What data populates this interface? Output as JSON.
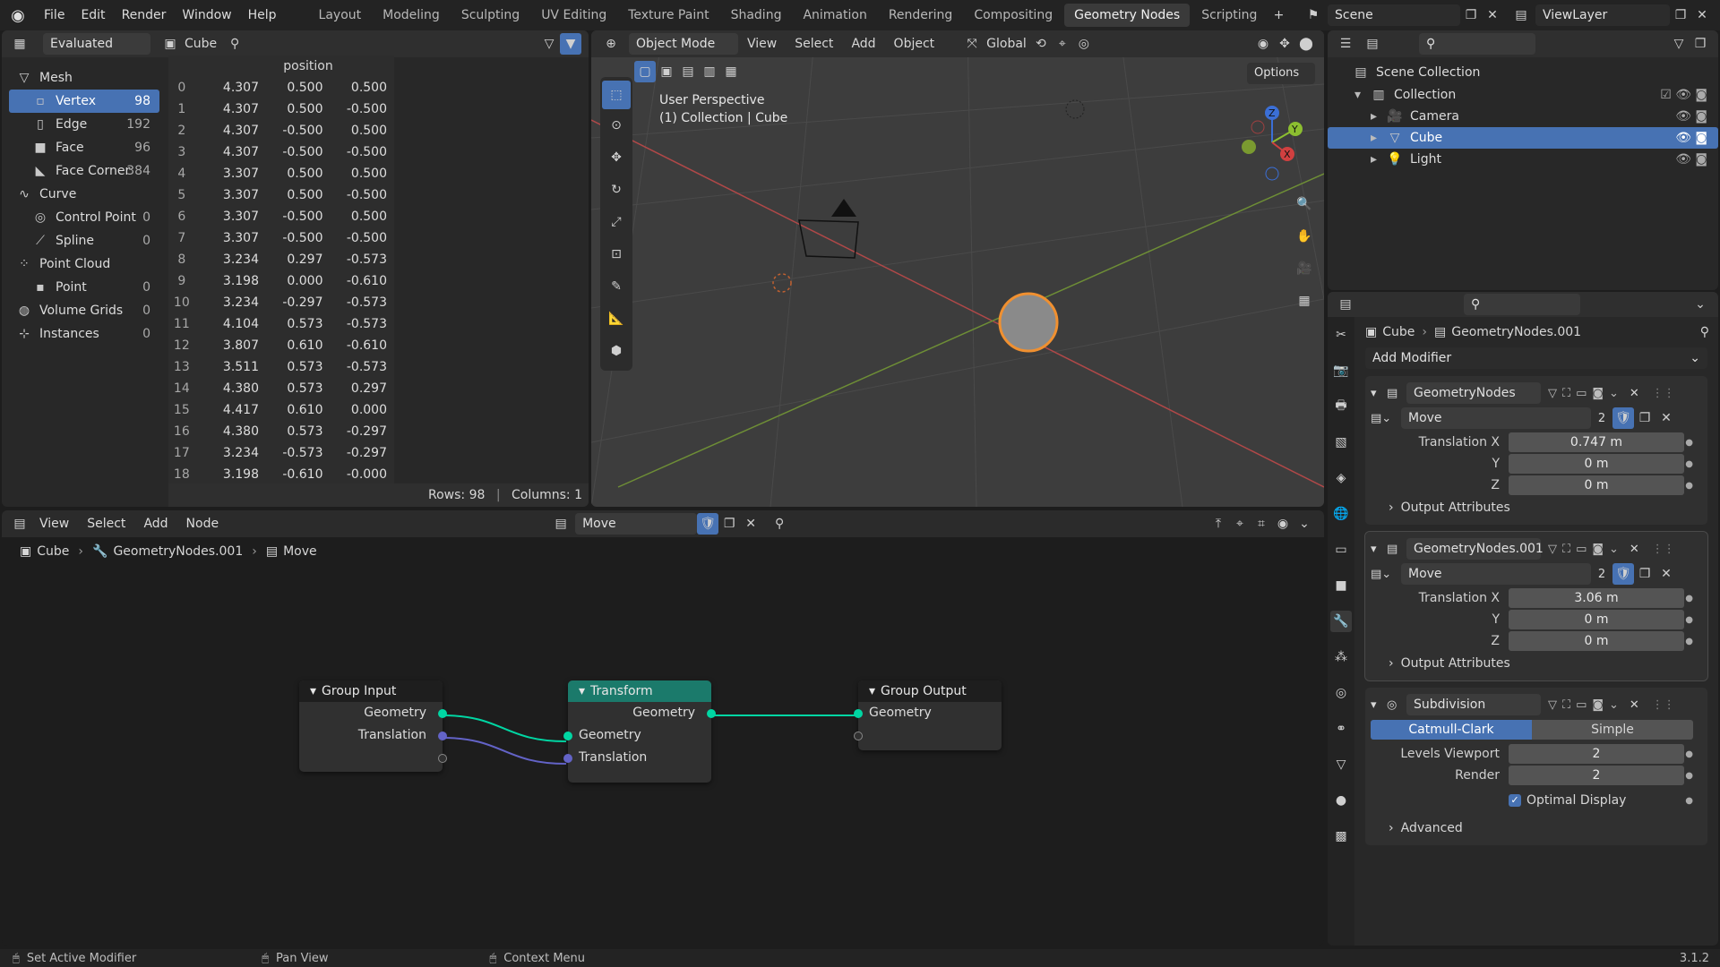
{
  "topbar": {
    "menus": [
      "File",
      "Edit",
      "Render",
      "Window",
      "Help"
    ],
    "workspaces": [
      "Layout",
      "Modeling",
      "Sculpting",
      "UV Editing",
      "Texture Paint",
      "Shading",
      "Animation",
      "Rendering",
      "Compositing",
      "Geometry Nodes",
      "Scripting"
    ],
    "active_workspace": "Geometry Nodes",
    "scene": "Scene",
    "viewlayer": "ViewLayer"
  },
  "spreadsheet": {
    "mode": "Evaluated",
    "object": "Cube",
    "column_header": "position",
    "tree": [
      {
        "label": "Mesh",
        "count": "",
        "indent": 0,
        "icon": "mesh-icon"
      },
      {
        "label": "Vertex",
        "count": "98",
        "indent": 1,
        "icon": "vertex-icon",
        "selected": true
      },
      {
        "label": "Edge",
        "count": "192",
        "indent": 1,
        "icon": "edge-icon"
      },
      {
        "label": "Face",
        "count": "96",
        "indent": 1,
        "icon": "face-icon"
      },
      {
        "label": "Face Corner",
        "count": "384",
        "indent": 1,
        "icon": "face-corner-icon"
      },
      {
        "label": "Curve",
        "count": "",
        "indent": 0,
        "icon": "curve-icon"
      },
      {
        "label": "Control Point",
        "count": "0",
        "indent": 1,
        "icon": "control-point-icon"
      },
      {
        "label": "Spline",
        "count": "0",
        "indent": 1,
        "icon": "spline-icon"
      },
      {
        "label": "Point Cloud",
        "count": "",
        "indent": 0,
        "icon": "point-cloud-icon"
      },
      {
        "label": "Point",
        "count": "0",
        "indent": 1,
        "icon": "point-icon"
      },
      {
        "label": "Volume Grids",
        "count": "0",
        "indent": 0,
        "icon": "volume-icon"
      },
      {
        "label": "Instances",
        "count": "0",
        "indent": 0,
        "icon": "instances-icon"
      }
    ],
    "rows": [
      [
        "0",
        "4.307",
        "0.500",
        "0.500"
      ],
      [
        "1",
        "4.307",
        "0.500",
        "-0.500"
      ],
      [
        "2",
        "4.307",
        "-0.500",
        "0.500"
      ],
      [
        "3",
        "4.307",
        "-0.500",
        "-0.500"
      ],
      [
        "4",
        "3.307",
        "0.500",
        "0.500"
      ],
      [
        "5",
        "3.307",
        "0.500",
        "-0.500"
      ],
      [
        "6",
        "3.307",
        "-0.500",
        "0.500"
      ],
      [
        "7",
        "3.307",
        "-0.500",
        "-0.500"
      ],
      [
        "8",
        "3.234",
        "0.297",
        "-0.573"
      ],
      [
        "9",
        "3.198",
        "0.000",
        "-0.610"
      ],
      [
        "10",
        "3.234",
        "-0.297",
        "-0.573"
      ],
      [
        "11",
        "4.104",
        "0.573",
        "-0.573"
      ],
      [
        "12",
        "3.807",
        "0.610",
        "-0.610"
      ],
      [
        "13",
        "3.511",
        "0.573",
        "-0.573"
      ],
      [
        "14",
        "4.380",
        "0.573",
        "0.297"
      ],
      [
        "15",
        "4.417",
        "0.610",
        "0.000"
      ],
      [
        "16",
        "4.380",
        "0.573",
        "-0.297"
      ],
      [
        "17",
        "3.234",
        "-0.573",
        "-0.297"
      ],
      [
        "18",
        "3.198",
        "-0.610",
        "-0.000"
      ]
    ],
    "footer_rows": "Rows: 98",
    "footer_cols": "Columns: 1"
  },
  "viewport": {
    "mode": "Object Mode",
    "menus": [
      "View",
      "Select",
      "Add",
      "Object"
    ],
    "orientation": "Global",
    "options": "Options",
    "overlay_title": "User Perspective",
    "overlay_sub": "(1) Collection | Cube"
  },
  "outliner": {
    "root": "Scene Collection",
    "collection": "Collection",
    "items": [
      {
        "label": "Camera",
        "icon": "camera-icon"
      },
      {
        "label": "Cube",
        "icon": "mesh-object-icon",
        "selected": true
      },
      {
        "label": "Light",
        "icon": "light-icon"
      }
    ]
  },
  "properties": {
    "breadcrumb_obj": "Cube",
    "breadcrumb_tree": "GeometryNodes.001",
    "add_modifier": "Add Modifier",
    "mod1": {
      "name": "GeometryNodes",
      "group": "Move",
      "users": "2",
      "tx_label": "Translation X",
      "tx": "0.747 m",
      "ty_label": "Y",
      "ty": "0 m",
      "tz_label": "Z",
      "tz": "0 m",
      "out": "Output Attributes"
    },
    "mod2": {
      "name": "GeometryNodes.001",
      "group": "Move",
      "users": "2",
      "tx_label": "Translation X",
      "tx": "3.06 m",
      "ty_label": "Y",
      "ty": "0 m",
      "tz_label": "Z",
      "tz": "0 m",
      "out": "Output Attributes"
    },
    "mod3": {
      "name": "Subdivision",
      "opt_a": "Catmull-Clark",
      "opt_b": "Simple",
      "lv_label": "Levels Viewport",
      "lv": "2",
      "r_label": "Render",
      "r": "2",
      "opt_label": "Optimal Display",
      "adv": "Advanced"
    }
  },
  "nodeeditor": {
    "menus": [
      "View",
      "Select",
      "Add",
      "Node"
    ],
    "tree": "Move",
    "bc_obj": "Cube",
    "bc_mod": "GeometryNodes.001",
    "bc_tree": "Move",
    "group_input": {
      "title": "Group Input",
      "out1": "Geometry",
      "out2": "Translation"
    },
    "transform": {
      "title": "Transform",
      "out": "Geometry",
      "in1": "Geometry",
      "in2": "Translation"
    },
    "group_output": {
      "title": "Group Output",
      "in": "Geometry"
    }
  },
  "status": {
    "a": "Set Active Modifier",
    "b": "Pan View",
    "c": "Context Menu",
    "version": "3.1.2"
  }
}
